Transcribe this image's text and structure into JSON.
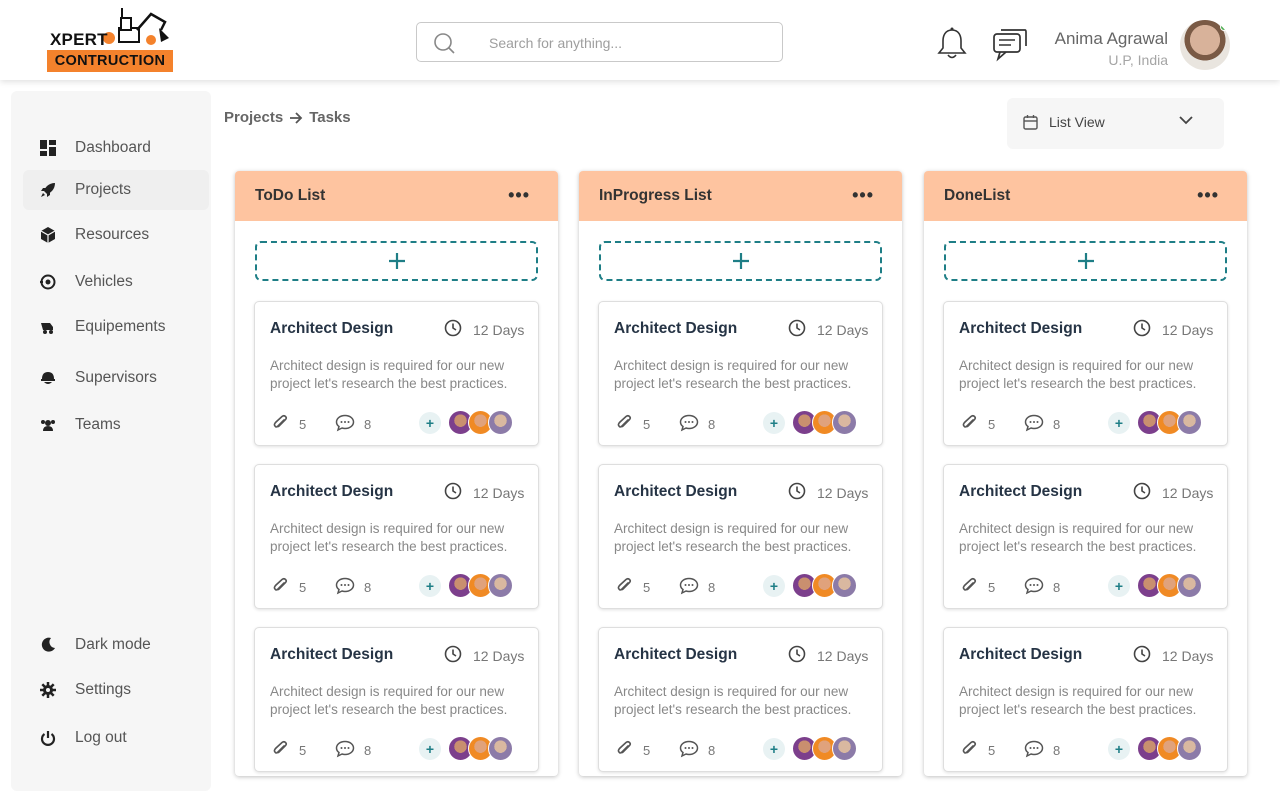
{
  "brand": {
    "logo_line1": "XPERT",
    "logo_line2": "CONTRUCTION",
    "accent_color": "#f4822c",
    "column_header_color": "#fec4a0",
    "teal_color": "#1e7e86"
  },
  "header": {
    "search_placeholder": "Search for anything...",
    "user_name": "Anima Agrawal",
    "user_location": "U.P, India",
    "icons": [
      "search-icon",
      "bell-icon",
      "chat-icon",
      "avatar"
    ]
  },
  "sidebar": {
    "items": [
      {
        "label": "Dashboard",
        "icon": "dashboard-icon"
      },
      {
        "label": "Projects",
        "icon": "rocket-icon",
        "active": true
      },
      {
        "label": "Resources",
        "icon": "cube-icon"
      },
      {
        "label": "Vehicles",
        "icon": "vehicle-icon"
      },
      {
        "label": "Equipements",
        "icon": "equipment-icon"
      },
      {
        "label": "Supervisors",
        "icon": "helmet-icon"
      },
      {
        "label": "Teams",
        "icon": "team-icon"
      }
    ],
    "bottom_items": [
      {
        "label": "Dark mode",
        "icon": "moon-icon"
      },
      {
        "label": "Settings",
        "icon": "gear-icon"
      },
      {
        "label": "Log out",
        "icon": "power-icon"
      }
    ]
  },
  "breadcrumb": {
    "parent": "Projects",
    "current": "Tasks"
  },
  "view_select": {
    "value": "List View"
  },
  "columns": [
    {
      "title": "ToDo List",
      "cards": [
        {
          "title": "Architect Design",
          "days": "12 Days",
          "desc": "Architect design is required for our new project let's research the best practices.",
          "attachments": "5",
          "comments": "8"
        },
        {
          "title": "Architect Design",
          "days": "12 Days",
          "desc": "Architect design is required for our new project let's research the best practices.",
          "attachments": "5",
          "comments": "8"
        },
        {
          "title": "Architect Design",
          "days": "12 Days",
          "desc": "Architect design is required for our new project let's research the best practices.",
          "attachments": "5",
          "comments": "8"
        }
      ]
    },
    {
      "title": "InProgress List",
      "cards": [
        {
          "title": "Architect Design",
          "days": "12 Days",
          "desc": "Architect design is required for our new project let's research the best practices.",
          "attachments": "5",
          "comments": "8"
        },
        {
          "title": "Architect Design",
          "days": "12 Days",
          "desc": "Architect design is required for our new project let's research the best practices.",
          "attachments": "5",
          "comments": "8"
        },
        {
          "title": "Architect Design",
          "days": "12 Days",
          "desc": "Architect design is required for our new project let's research the best practices.",
          "attachments": "5",
          "comments": "8"
        }
      ]
    },
    {
      "title": "DoneList",
      "cards": [
        {
          "title": "Architect Design",
          "days": "12 Days",
          "desc": "Architect design is required for our new project let's research the best practices.",
          "attachments": "5",
          "comments": "8"
        },
        {
          "title": "Architect Design",
          "days": "12 Days",
          "desc": "Architect design is required for our new project let's research the best practices.",
          "attachments": "5",
          "comments": "8"
        },
        {
          "title": "Architect Design",
          "days": "12 Days",
          "desc": "Architect design is required for our new project let's research the best practices.",
          "attachments": "5",
          "comments": "8"
        }
      ]
    }
  ],
  "symbols": {
    "more": "•••",
    "add": "+"
  }
}
